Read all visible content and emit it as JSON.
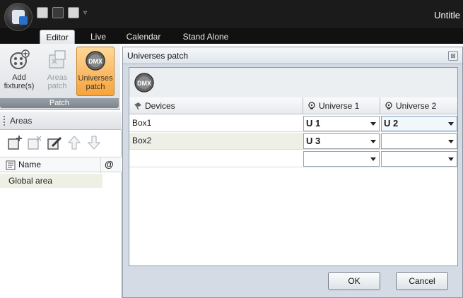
{
  "window": {
    "title": "Untitle"
  },
  "ribbon_tabs": [
    {
      "label": "Editor",
      "active": true
    },
    {
      "label": "Live",
      "active": false
    },
    {
      "label": "Calendar",
      "active": false
    },
    {
      "label": "Stand Alone",
      "active": false
    }
  ],
  "ribbon": {
    "buttons": [
      {
        "label": "Add fixture(s)",
        "icon": "add-fixture-icon",
        "state": "normal"
      },
      {
        "label": "Areas patch",
        "icon": "areas-patch-icon",
        "state": "disabled"
      },
      {
        "label": "Universes patch",
        "icon": "dmx-icon",
        "state": "selected"
      }
    ],
    "group_label": "Patch"
  },
  "areas_panel": {
    "title": "Areas",
    "tools": [
      "add-area-icon",
      "remove-area-icon",
      "edit-area-icon",
      "move-up-icon",
      "move-down-icon"
    ],
    "columns": {
      "name": "Name",
      "at": "@"
    },
    "rows": [
      {
        "name": "Global area"
      }
    ]
  },
  "dialog": {
    "title": "Universes patch",
    "close_glyph": "⊠",
    "headers": {
      "devices": "Devices",
      "universe1": "Universe 1",
      "universe2": "Universe 2"
    },
    "rows": [
      {
        "device": "Box1",
        "u1": "U 1",
        "u2": "U 2"
      },
      {
        "device": "Box2",
        "u1": "U 3",
        "u2": ""
      },
      {
        "device": "",
        "u1": "",
        "u2": ""
      }
    ],
    "ok_label": "OK",
    "cancel_label": "Cancel"
  },
  "colors": {
    "selected_button": "#f7a33a",
    "chrome": "#1b1b1b",
    "dialog_bg": "#d4dbe4"
  }
}
